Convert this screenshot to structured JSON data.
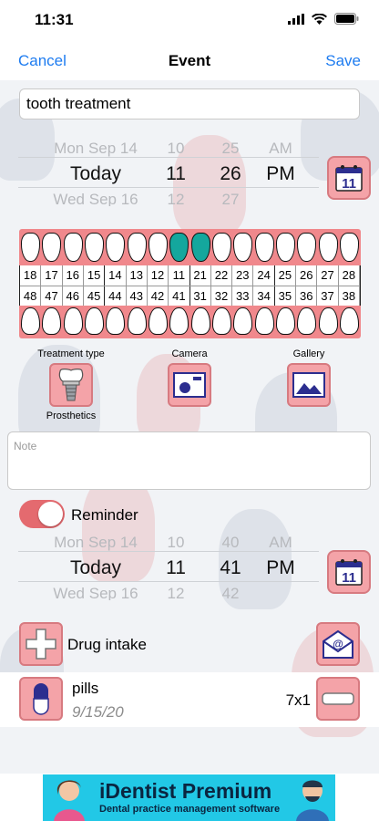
{
  "status_bar": {
    "time": "11:31",
    "icons": [
      "signal-icon",
      "wifi-icon",
      "battery-icon"
    ]
  },
  "navbar": {
    "cancel": "Cancel",
    "title": "Event",
    "save": "Save"
  },
  "event": {
    "title_value": "tooth treatment"
  },
  "date_picker": {
    "day_prev": "Mon Sep 14",
    "day_sel": "Today",
    "day_next": "Wed Sep 16",
    "hour_prev": "10",
    "hour_sel": "11",
    "hour_next": "12",
    "min_prev": "25",
    "min_sel": "26",
    "min_next": "27",
    "ampm_prev": "AM",
    "ampm_sel": "PM"
  },
  "calendar_icon_day": "11",
  "tooth_chart": {
    "upper_numbers": [
      "18",
      "17",
      "16",
      "15",
      "14",
      "13",
      "12",
      "11",
      "21",
      "22",
      "23",
      "24",
      "25",
      "26",
      "27",
      "28"
    ],
    "lower_numbers": [
      "48",
      "47",
      "46",
      "45",
      "44",
      "43",
      "42",
      "41",
      "31",
      "32",
      "33",
      "34",
      "35",
      "36",
      "37",
      "38"
    ],
    "selected_upper": [
      "11",
      "21"
    ]
  },
  "actions": {
    "treatment_type_label": "Treatment type",
    "treatment_type_value": "Prosthetics",
    "camera_label": "Camera",
    "gallery_label": "Gallery"
  },
  "note": {
    "placeholder": "Note"
  },
  "reminder": {
    "label": "Reminder",
    "enabled": true,
    "day_prev": "Mon Sep 14",
    "day_sel": "Today",
    "day_next": "Wed Sep 16",
    "hour_prev": "10",
    "hour_sel": "11",
    "hour_next": "12",
    "min_prev": "40",
    "min_sel": "41",
    "min_next": "42",
    "ampm_prev": "AM",
    "ampm_sel": "PM"
  },
  "drug": {
    "label": "Drug intake"
  },
  "drug_items": [
    {
      "name": "pills",
      "date": "9/15/20",
      "dose": "7x1"
    }
  ],
  "ad": {
    "title": "iDentist Premium",
    "subtitle": "Dental practice management software"
  },
  "colors": {
    "accent": "#1e7cf0",
    "gum": "#f0888c",
    "button": "#f4a3a8",
    "selected_tooth": "#14a79d",
    "toggle": "#e46a6f"
  }
}
